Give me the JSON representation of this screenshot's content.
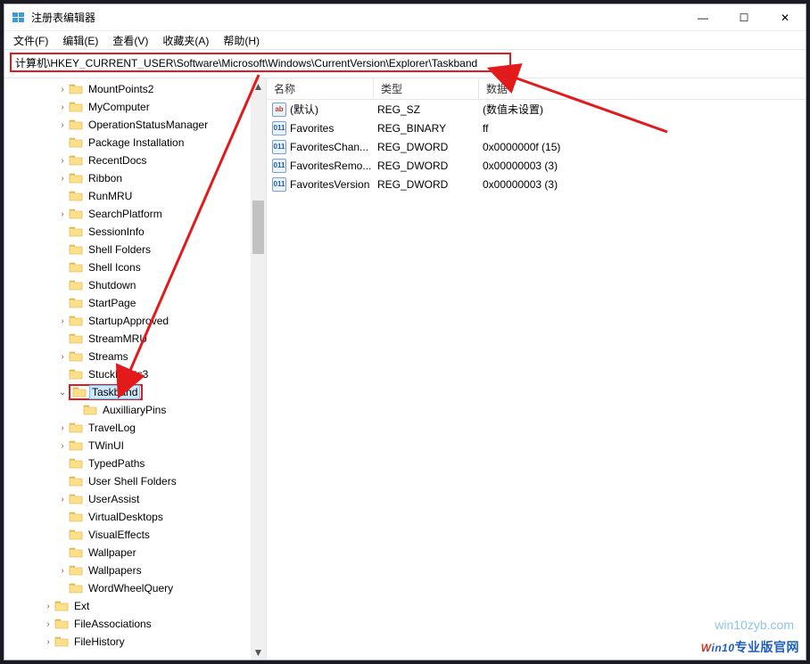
{
  "window": {
    "title": "注册表编辑器",
    "minimize_glyph": "—",
    "maximize_glyph": "☐",
    "close_glyph": "✕"
  },
  "menu": {
    "file": "文件(F)",
    "edit": "编辑(E)",
    "view": "查看(V)",
    "favorites": "收藏夹(A)",
    "help": "帮助(H)"
  },
  "address": {
    "path": "计算机\\HKEY_CURRENT_USER\\Software\\Microsoft\\Windows\\CurrentVersion\\Explorer\\Taskband"
  },
  "columns": {
    "name": "名称",
    "type": "类型",
    "data": "数据"
  },
  "values": [
    {
      "icon": "str",
      "iconText": "ab",
      "name": "(默认)",
      "type": "REG_SZ",
      "data": "(数值未设置)"
    },
    {
      "icon": "bin",
      "iconText": "011",
      "name": "Favorites",
      "type": "REG_BINARY",
      "data": "ff"
    },
    {
      "icon": "bin",
      "iconText": "011",
      "name": "FavoritesChan...",
      "type": "REG_DWORD",
      "data": "0x0000000f (15)"
    },
    {
      "icon": "bin",
      "iconText": "011",
      "name": "FavoritesRemo...",
      "type": "REG_DWORD",
      "data": "0x00000003 (3)"
    },
    {
      "icon": "bin",
      "iconText": "011",
      "name": "FavoritesVersion",
      "type": "REG_DWORD",
      "data": "0x00000003 (3)"
    }
  ],
  "tree": [
    {
      "indent": 3,
      "twisty": ">",
      "label": "MountPoints2"
    },
    {
      "indent": 3,
      "twisty": ">",
      "label": "MyComputer"
    },
    {
      "indent": 3,
      "twisty": ">",
      "label": "OperationStatusManager"
    },
    {
      "indent": 3,
      "twisty": "",
      "label": "Package Installation"
    },
    {
      "indent": 3,
      "twisty": ">",
      "label": "RecentDocs"
    },
    {
      "indent": 3,
      "twisty": ">",
      "label": "Ribbon"
    },
    {
      "indent": 3,
      "twisty": "",
      "label": "RunMRU"
    },
    {
      "indent": 3,
      "twisty": ">",
      "label": "SearchPlatform"
    },
    {
      "indent": 3,
      "twisty": "",
      "label": "SessionInfo"
    },
    {
      "indent": 3,
      "twisty": "",
      "label": "Shell Folders"
    },
    {
      "indent": 3,
      "twisty": "",
      "label": "Shell Icons"
    },
    {
      "indent": 3,
      "twisty": "",
      "label": "Shutdown"
    },
    {
      "indent": 3,
      "twisty": "",
      "label": "StartPage"
    },
    {
      "indent": 3,
      "twisty": ">",
      "label": "StartupApproved"
    },
    {
      "indent": 3,
      "twisty": "",
      "label": "StreamMRU"
    },
    {
      "indent": 3,
      "twisty": ">",
      "label": "Streams"
    },
    {
      "indent": 3,
      "twisty": "",
      "label": "StuckRects3"
    },
    {
      "indent": 3,
      "twisty": "v",
      "label": "Taskband",
      "selected": true,
      "highlight": true
    },
    {
      "indent": 4,
      "twisty": "",
      "label": "AuxilliaryPins"
    },
    {
      "indent": 3,
      "twisty": ">",
      "label": "TravelLog"
    },
    {
      "indent": 3,
      "twisty": ">",
      "label": "TWinUI"
    },
    {
      "indent": 3,
      "twisty": "",
      "label": "TypedPaths"
    },
    {
      "indent": 3,
      "twisty": "",
      "label": "User Shell Folders"
    },
    {
      "indent": 3,
      "twisty": ">",
      "label": "UserAssist"
    },
    {
      "indent": 3,
      "twisty": "",
      "label": "VirtualDesktops"
    },
    {
      "indent": 3,
      "twisty": "",
      "label": "VisualEffects"
    },
    {
      "indent": 3,
      "twisty": "",
      "label": "Wallpaper"
    },
    {
      "indent": 3,
      "twisty": ">",
      "label": "Wallpapers"
    },
    {
      "indent": 3,
      "twisty": "",
      "label": "WordWheelQuery"
    },
    {
      "indent": 2,
      "twisty": ">",
      "label": "Ext"
    },
    {
      "indent": 2,
      "twisty": ">",
      "label": "FileAssociations"
    },
    {
      "indent": 2,
      "twisty": ">",
      "label": "FileHistory"
    }
  ],
  "watermark": {
    "line1": "win10zyb.com",
    "line2a": "W",
    "line2b": "in10",
    "line2c": "专业版官网"
  },
  "scroll": {
    "up": "▲",
    "down": "▼"
  }
}
